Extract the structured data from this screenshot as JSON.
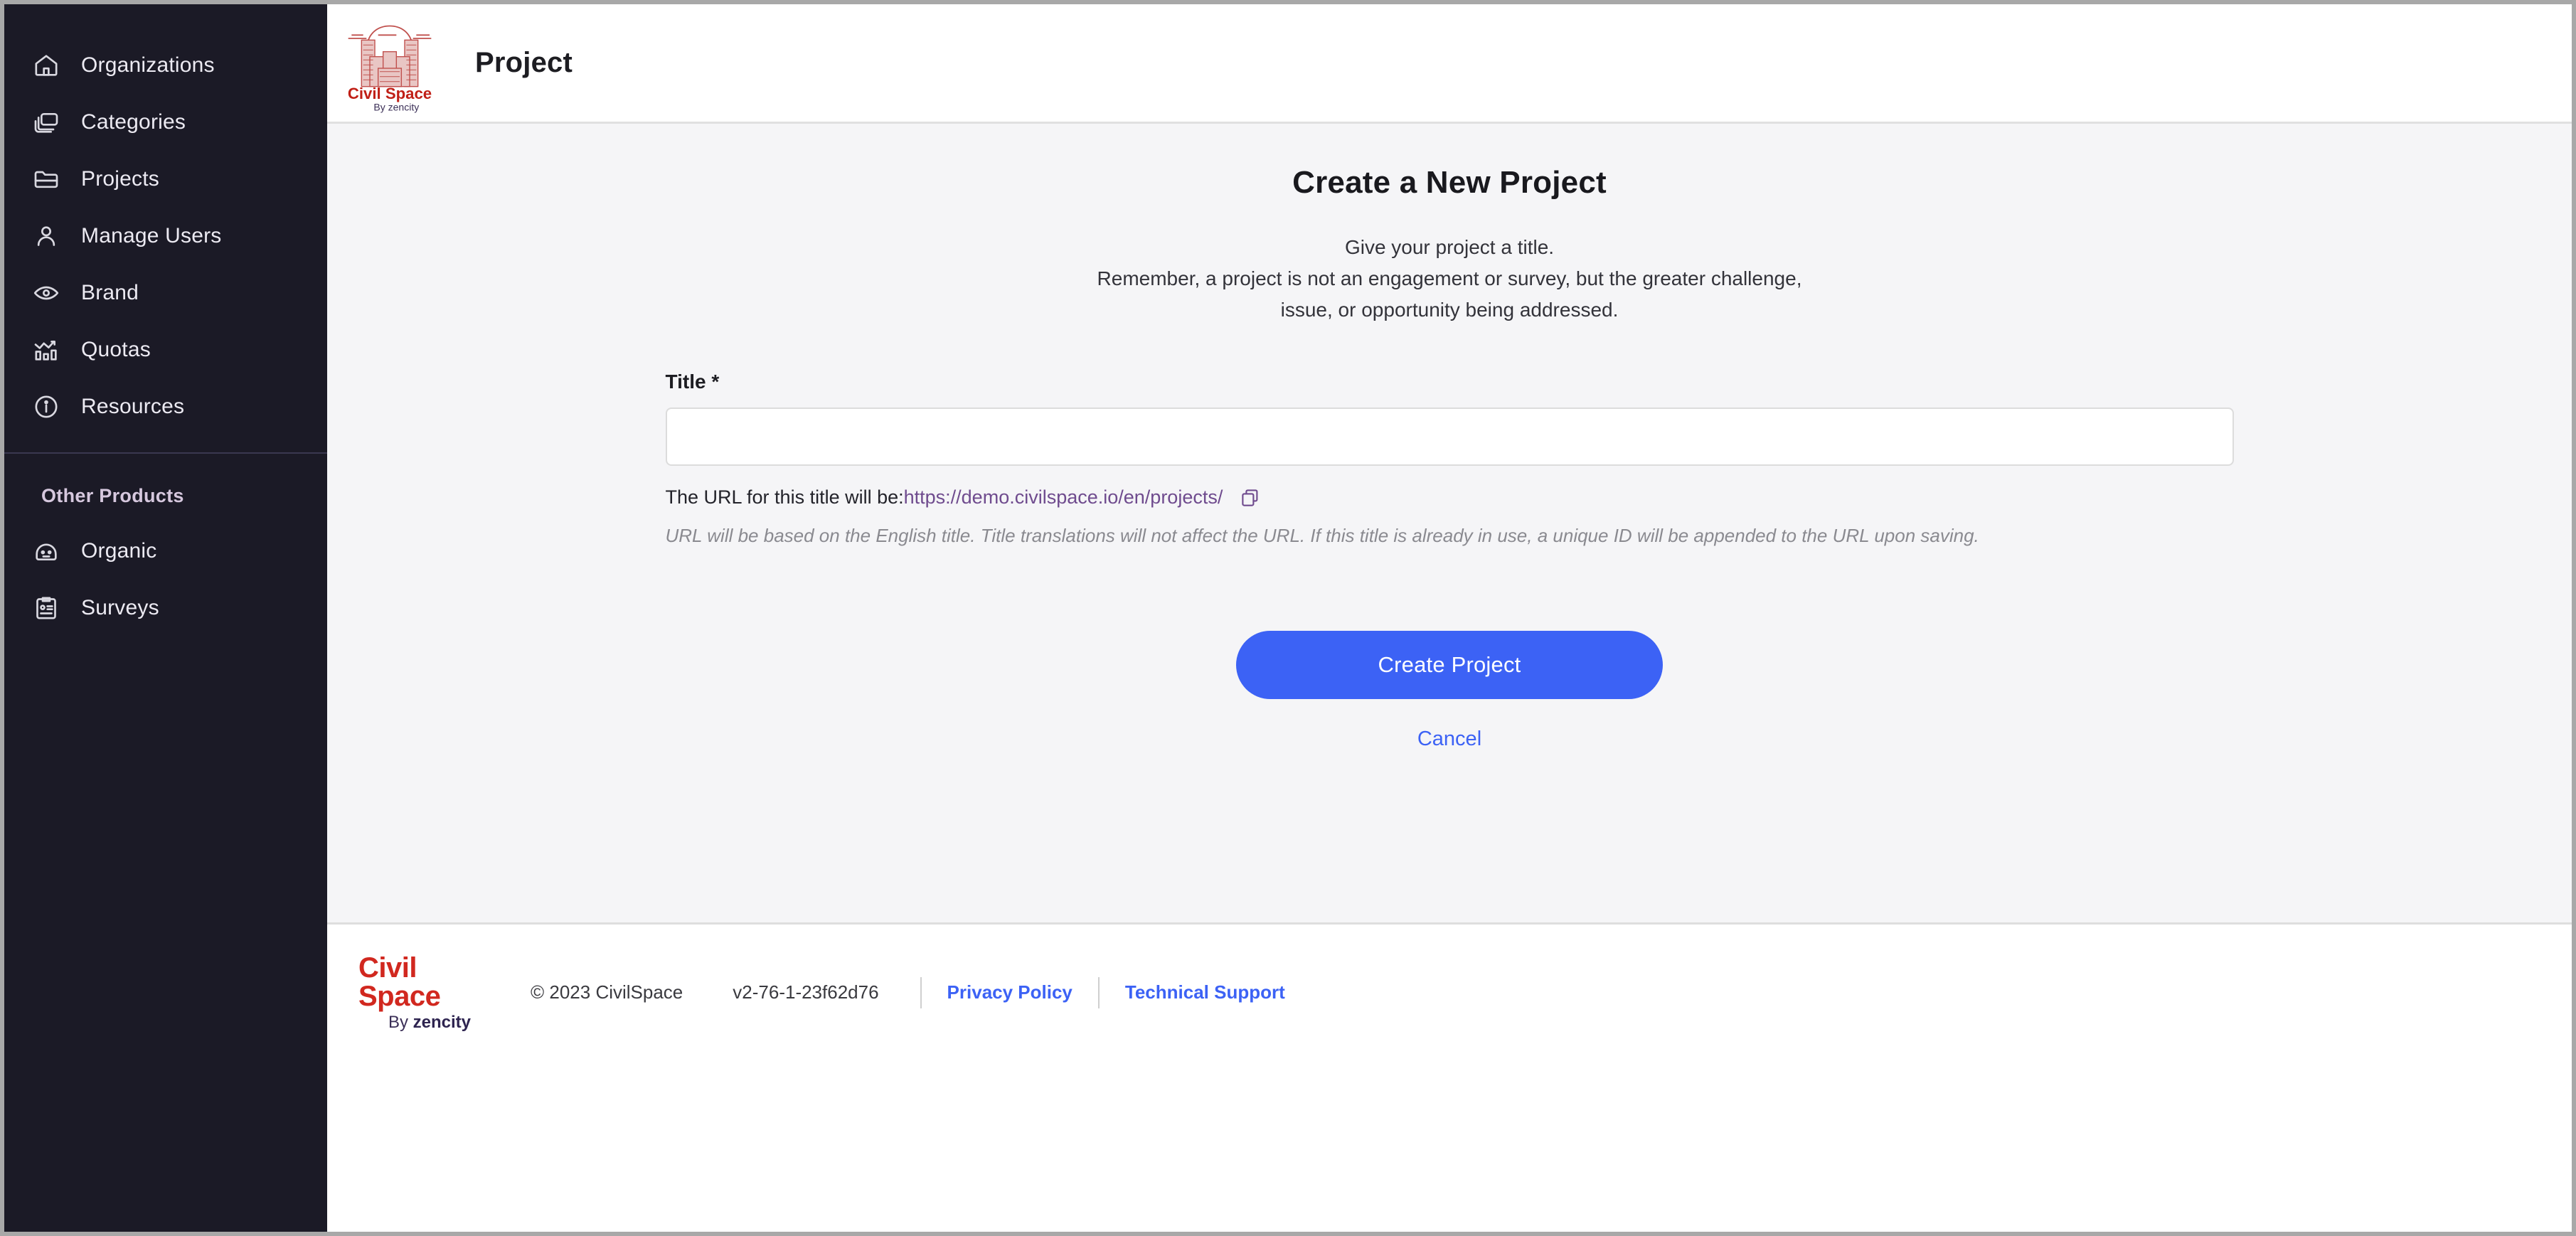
{
  "sidebar": {
    "items": [
      {
        "label": "Organizations",
        "icon": "home-icon"
      },
      {
        "label": "Categories",
        "icon": "layers-icon"
      },
      {
        "label": "Projects",
        "icon": "folder-icon"
      },
      {
        "label": "Manage Users",
        "icon": "user-icon"
      },
      {
        "label": "Brand",
        "icon": "eye-icon"
      },
      {
        "label": "Quotas",
        "icon": "chart-trend-icon"
      },
      {
        "label": "Resources",
        "icon": "info-circle-icon"
      }
    ],
    "section_title": "Other Products",
    "other_products": [
      {
        "label": "Organic",
        "icon": "face-icon"
      },
      {
        "label": "Surveys",
        "icon": "clipboard-icon"
      }
    ]
  },
  "header": {
    "title": "Project",
    "logo_main": "Civil Space",
    "logo_sub_prefix": "By ",
    "logo_sub_name": "zencity"
  },
  "main": {
    "heading": "Create a New Project",
    "subtitle_line1": "Give your project a title.",
    "subtitle_line2": "Remember, a project is not an engagement or survey, but the greater challenge,",
    "subtitle_line3": "issue, or opportunity being addressed.",
    "title_label": "Title *",
    "title_value": "",
    "title_placeholder": "",
    "url_prefix": "The URL for this title will be:",
    "url_value": "https://demo.civilspace.io/en/projects/",
    "url_note": "URL will be based on the English title. Title translations will not affect the URL. If this title is already in use, a unique ID will be appended to the URL upon saving.",
    "create_button": "Create Project",
    "cancel_link": "Cancel"
  },
  "footer": {
    "logo_main": "Civil Space",
    "logo_sub_prefix": "By ",
    "logo_sub_name": "zencity",
    "copyright": "© 2023 CivilSpace",
    "version": "v2-76-1-23f62d76",
    "privacy_link": "Privacy Policy",
    "support_link": "Technical Support"
  },
  "colors": {
    "sidebar_bg": "#1b1a26",
    "accent_blue": "#3c62f5",
    "brand_red": "#d1281f",
    "url_purple": "#6f4b8e",
    "content_bg": "#f5f5f7"
  }
}
